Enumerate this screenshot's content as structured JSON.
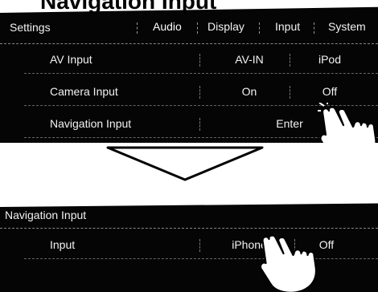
{
  "caption": {
    "text": "Navigation Input"
  },
  "top_panel": {
    "title": "Settings",
    "tabs": [
      "Audio",
      "Display",
      "Input",
      "System"
    ],
    "rows": [
      {
        "label": "AV Input",
        "options": [
          "AV-IN",
          "iPod"
        ]
      },
      {
        "label": "Camera Input",
        "options": [
          "On",
          "Off"
        ]
      },
      {
        "label": "Navigation Input",
        "options": [
          "Enter"
        ]
      }
    ]
  },
  "bottom_panel": {
    "title": "Navigation Input",
    "rows": [
      {
        "label": "Input",
        "options": [
          "iPhone",
          "Off"
        ]
      }
    ]
  },
  "colors": {
    "panel_bg": "#050505",
    "text": "#f2f2f2",
    "page_bg": "#ffffff"
  }
}
